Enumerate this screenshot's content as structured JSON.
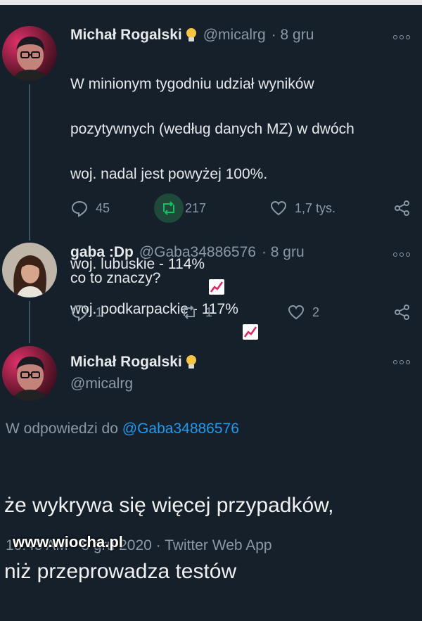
{
  "tweet1": {
    "name": "Michał Rogalski",
    "handle": "@micalrg",
    "time": "· 8 gru",
    "text_lines": [
      "W minionym tygodniu udział wyników",
      "pozytywnych (według danych MZ) w dwóch",
      "woj. nadal jest powyżej 100%."
    ],
    "line_lubuskie": "woj. lubuskie - 114%",
    "line_podkarpackie": "woj. podkarpackie - 117%",
    "replies": "45",
    "retweets": "217",
    "likes": "1,7 tys."
  },
  "tweet2": {
    "name": "gaba :Dp",
    "handle": "@Gaba34886576",
    "time": "· 8 gru",
    "text": "co to znaczy?",
    "replies": "1",
    "retweets": "1",
    "likes": "2"
  },
  "tweet3": {
    "name": "Michał Rogalski",
    "handle": "@micalrg",
    "reply_prefix": "W odpowiedzi do ",
    "reply_handle": "@Gaba34886576",
    "text_line1": "że wykrywa się więcej przypadków,",
    "text_line2": "niż przeprowadza testów",
    "meta": "10:45 AM · 8 gru 2020 · Twitter Web App"
  },
  "watermark": "www.wiocha.pl",
  "colors": {
    "background": "#15202b",
    "accent": "#1d9bf0",
    "muted": "#8b98a5",
    "retweet_highlight": "#1f4a3a"
  }
}
